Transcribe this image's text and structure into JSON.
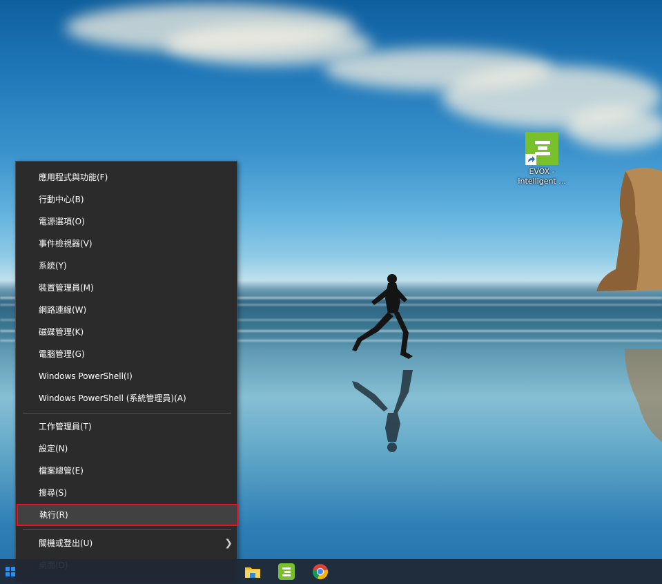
{
  "desktop": {
    "icons": [
      {
        "label": "EVOX - Intelligent ..."
      }
    ]
  },
  "menu": {
    "items": [
      {
        "label": "應用程式與功能(F)"
      },
      {
        "label": "行動中心(B)"
      },
      {
        "label": "電源選項(O)"
      },
      {
        "label": "事件檢視器(V)"
      },
      {
        "label": "系統(Y)"
      },
      {
        "label": "裝置管理員(M)"
      },
      {
        "label": "網路連線(W)"
      },
      {
        "label": "磁碟管理(K)"
      },
      {
        "label": "電腦管理(G)"
      },
      {
        "label": "Windows PowerShell(I)"
      },
      {
        "label": "Windows PowerShell (系統管理員)(A)"
      },
      {
        "label": "工作管理員(T)"
      },
      {
        "label": "設定(N)"
      },
      {
        "label": "檔案總管(E)"
      },
      {
        "label": "搜尋(S)"
      },
      {
        "label": "執行(R)",
        "highlighted": true
      },
      {
        "label": "關機或登出(U)",
        "submenu": true
      },
      {
        "label": "桌面(D)"
      }
    ],
    "highlight_color": "#e81123"
  },
  "taskbar": {
    "icons": [
      "start-icon",
      "file-explorer-icon",
      "evox-icon",
      "chrome-icon"
    ]
  },
  "colors": {
    "menu_bg": "#2b2b2b",
    "evox_green": "#78c02c"
  }
}
